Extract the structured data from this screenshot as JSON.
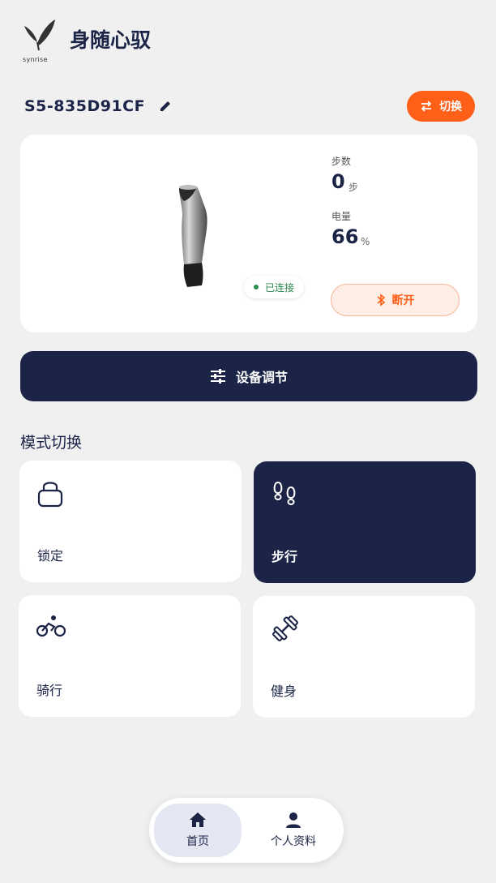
{
  "header": {
    "logo_text": "synrise",
    "title": "身随心驭",
    "logo_icon": "feather-logo-icon"
  },
  "device": {
    "name": "S5-835D91CF",
    "switch_label": "切换",
    "status_label": "已连接",
    "steps_label": "步数",
    "steps_value": "0",
    "steps_unit": "步",
    "battery_label": "电量",
    "battery_value": "66",
    "battery_unit": "%",
    "disconnect_label": "断开"
  },
  "adjust": {
    "label": "设备调节"
  },
  "modes": {
    "section_title": "模式切换",
    "items": [
      {
        "label": "锁定",
        "icon": "lock-icon",
        "active": false
      },
      {
        "label": "步行",
        "icon": "footprints-icon",
        "active": true
      },
      {
        "label": "骑行",
        "icon": "bicycle-icon",
        "active": false
      },
      {
        "label": "健身",
        "icon": "dumbbell-icon",
        "active": false
      }
    ]
  },
  "nav": {
    "home_label": "首页",
    "profile_label": "个人资料"
  },
  "colors": {
    "navy": "#1b2446",
    "accent_orange": "#ff5f17",
    "connected_green": "#2d8a4e",
    "background": "#f0f0f1"
  }
}
